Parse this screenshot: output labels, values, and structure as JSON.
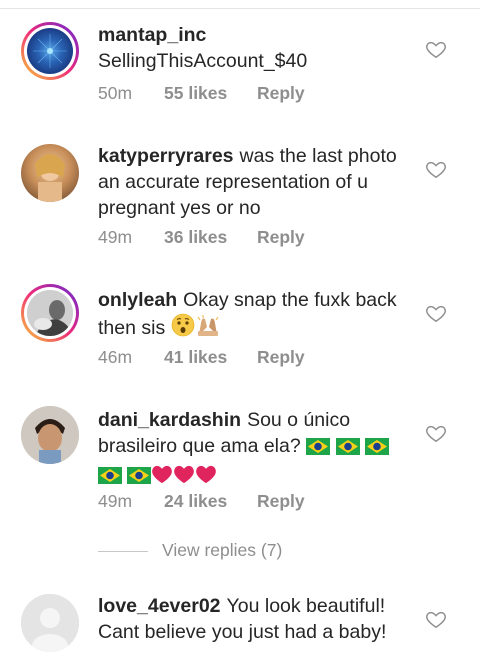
{
  "comments": [
    {
      "username": "mantap_inc",
      "text": "SellingThisAccount_$40",
      "time": "50m",
      "likes": "55 likes",
      "reply": "Reply"
    },
    {
      "username": "katyperryrares",
      "text": "was the last photo an accurate representation of u pregnant yes or no",
      "time": "49m",
      "likes": "36 likes",
      "reply": "Reply"
    },
    {
      "username": "onlyleah",
      "text": "Okay snap the fuxk back then sis",
      "time": "46m",
      "likes": "41 likes",
      "reply": "Reply"
    },
    {
      "username": "dani_kardashin",
      "text": "Sou o único brasileiro que ama ela?",
      "time": "49m",
      "likes": "24 likes",
      "reply": "Reply"
    },
    {
      "username": "love_4ever02",
      "text": "You look beautiful! Cant believe you just had a baby!"
    }
  ],
  "view_replies": "View replies (7)",
  "icons": {
    "heart": "heart-outline-icon",
    "hushed": "hushed-face-emoji",
    "pray": "folded-hands-emoji",
    "flag": "brazil-flag-emoji",
    "red_heart": "red-heart-emoji"
  },
  "colors": {
    "meta_text": "#8e8e8e",
    "text": "#262626",
    "heart_red": "#e0245e",
    "ring_start": "#f9ce34",
    "ring_end": "#6228d7"
  }
}
